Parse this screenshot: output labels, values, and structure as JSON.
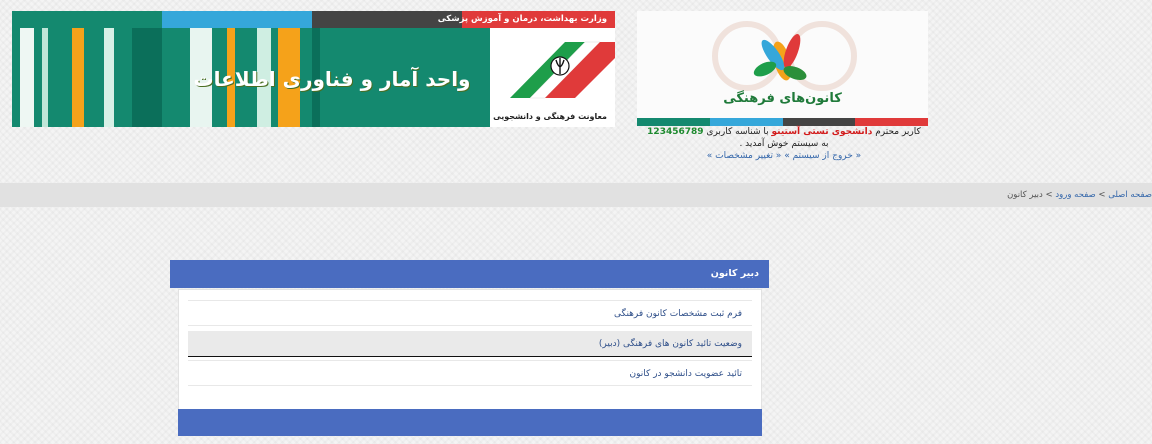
{
  "header": {
    "ministry_title": "وزارت بهداشت، درمان و آموزش پزشکی",
    "banner_title": "واحد آمار و فناوری اطلاعات",
    "emblem_label": "معاونت فرهنگی و دانشجویی",
    "logo_text": "کانون‌های فرهنگی",
    "colors": {
      "green": "#14896f",
      "teal": "#0f8c7a",
      "orange": "#f5a21a",
      "blue": "#35a7da",
      "dark": "#444",
      "red": "#e03a3a"
    }
  },
  "user": {
    "greeting_prefix": "کاربر محترم",
    "name": "دانشجوی تستی آستینو",
    "id_prefix": "با شناسه کاربری",
    "user_id": "123456789",
    "welcome": "به سیستم خوش آمدید .",
    "logout_link": "« خروج از سیستم »",
    "profile_link": "« تغییر مشخصات »"
  },
  "breadcrumb": {
    "home": "صفحه اصلی",
    "separator": ">",
    "login": "صفحه ورود",
    "current": "دبیر کانون"
  },
  "panel": {
    "title": "دبیر کانون",
    "items": [
      {
        "label": "فرم ثبت مشخصات کانون فرهنگی"
      },
      {
        "label": "وضعیت تائید کانون های فرهنگی (دبیر)"
      },
      {
        "label": "تائید عضویت دانشجو در کانون"
      }
    ]
  }
}
